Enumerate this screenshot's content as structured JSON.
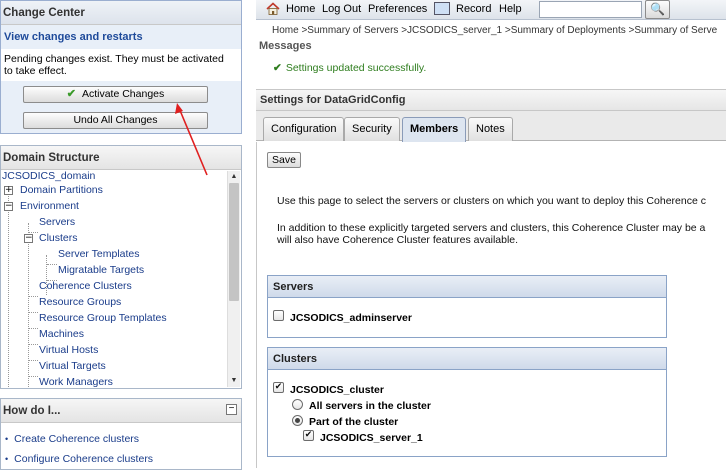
{
  "change_center": {
    "title": "Change Center",
    "view_link": "View changes and restarts",
    "pending_msg_1": "Pending changes exist. They must be activated",
    "pending_msg_2": "to take effect.",
    "activate_label": "Activate Changes",
    "undo_label": "Undo All Changes"
  },
  "domain_structure": {
    "title": "Domain Structure",
    "items": [
      {
        "label": "JCSODICS_domain"
      },
      {
        "label": "Domain Partitions"
      },
      {
        "label": "Environment"
      },
      {
        "label": "Servers"
      },
      {
        "label": "Clusters"
      },
      {
        "label": "Server Templates"
      },
      {
        "label": "Migratable Targets"
      },
      {
        "label": "Coherence Clusters"
      },
      {
        "label": "Resource Groups"
      },
      {
        "label": "Resource Group Templates"
      },
      {
        "label": "Machines"
      },
      {
        "label": "Virtual Hosts"
      },
      {
        "label": "Virtual Targets"
      },
      {
        "label": "Work Managers"
      }
    ]
  },
  "how_do_i": {
    "title": "How do I...",
    "links": [
      "Create Coherence clusters",
      "Configure Coherence clusters"
    ]
  },
  "topbar": {
    "home": "Home",
    "logout": "Log Out",
    "preferences": "Preferences",
    "record": "Record",
    "help": "Help",
    "search_value": ""
  },
  "breadcrumb": "Home >Summary of Servers >JCSODICS_server_1 >Summary of Deployments >Summary of Serve",
  "messages": {
    "title": "Messages",
    "success": "Settings updated successfully."
  },
  "settings": {
    "title": "Settings for DataGridConfig",
    "tabs": [
      "Configuration",
      "Security",
      "Members",
      "Notes"
    ],
    "active_tab": "Members"
  },
  "members": {
    "save_label": "Save",
    "desc_1": "Use this page to select the servers or clusters on which you want to deploy this Coherence c",
    "desc_2": "In addition to these explicitly targeted servers and clusters, this Coherence Cluster may be a",
    "desc_3": "will also have Coherence Cluster features available.",
    "servers_header": "Servers",
    "server_item": "JCSODICS_adminserver",
    "server_checked": false,
    "clusters_header": "Clusters",
    "cluster_item": "JCSODICS_cluster",
    "cluster_checked": true,
    "opt_all": "All servers in the cluster",
    "opt_part": "Part of the cluster",
    "selected_option": "Part of the cluster",
    "member_server": "JCSODICS_server_1",
    "member_checked": true
  },
  "colors": {
    "link": "#1a3c8a",
    "success": "#2e7d1e",
    "annotation_arrow": "#e02020",
    "section_border": "#8aa3c7"
  }
}
